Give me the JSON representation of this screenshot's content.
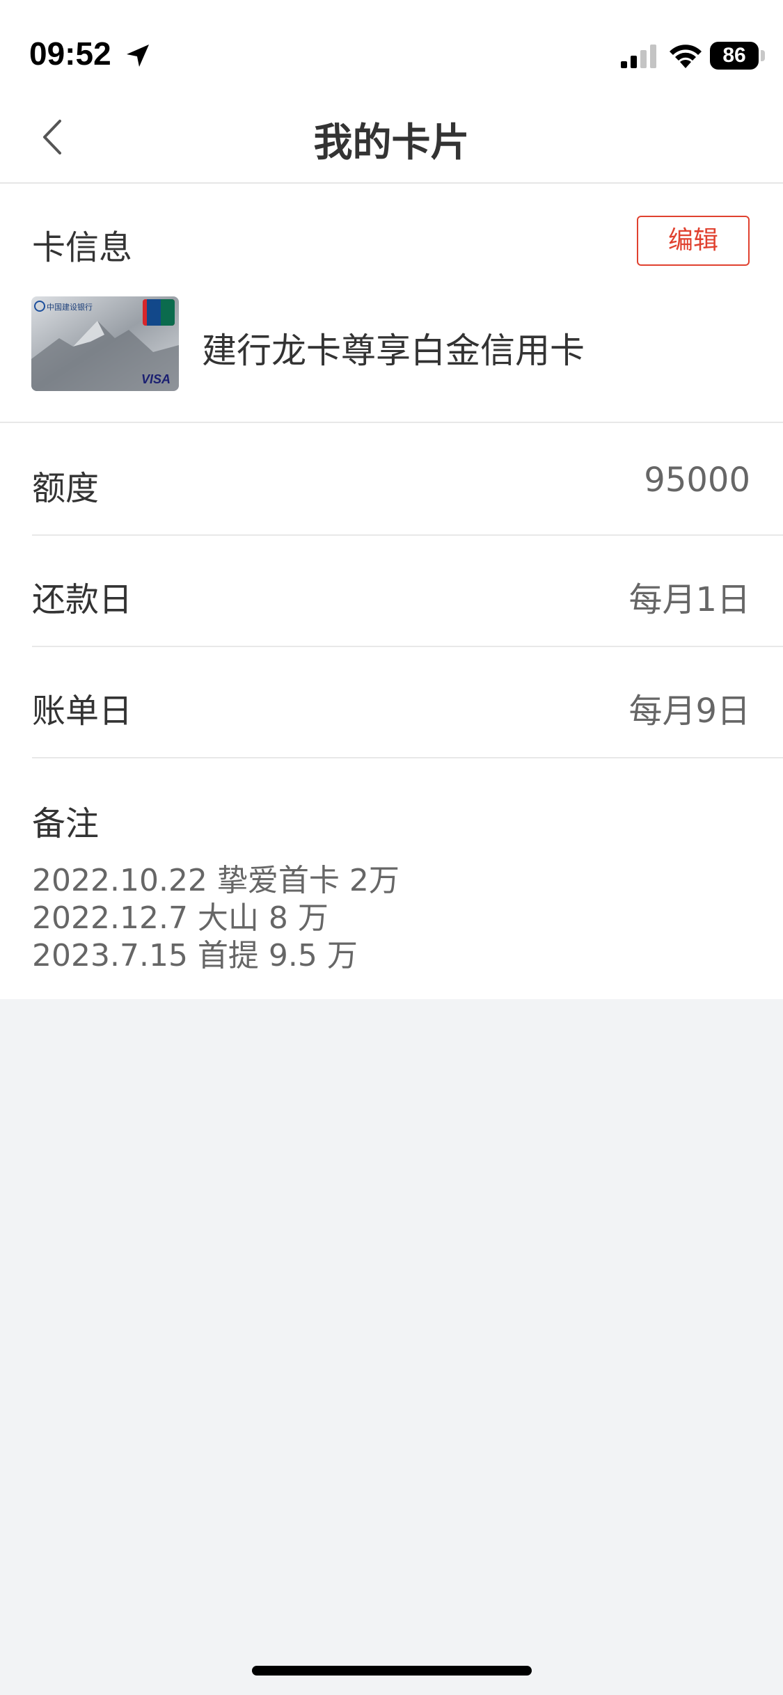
{
  "status_bar": {
    "time": "09:52",
    "battery": "86",
    "icons": [
      "location-arrow-icon",
      "cellular-signal-icon",
      "wifi-icon",
      "battery-icon"
    ]
  },
  "nav": {
    "title": "我的卡片",
    "back_icon": "chevron-left-icon"
  },
  "card_info": {
    "section_title": "卡信息",
    "edit_label": "编辑",
    "card_name": "建行龙卡尊享白金信用卡",
    "card_image": {
      "bank_text": "中国建设银行",
      "network_text": "VISA",
      "unionpay_text": "UnionPay 银联"
    }
  },
  "details": [
    {
      "label": "额度",
      "value": "95000"
    },
    {
      "label": "还款日",
      "value": "每月1日"
    },
    {
      "label": "账单日",
      "value": "每月9日"
    }
  ],
  "notes": {
    "title": "备注",
    "lines": [
      "2022.10.22 挚爱首卡 2万",
      "2022.12.7 大山 8 万",
      "2023.7.15 首提 9.5 万"
    ]
  },
  "colors": {
    "accent": "#e0412f",
    "background": "#f2f3f5",
    "text_primary": "#333333",
    "text_secondary": "#666666"
  }
}
